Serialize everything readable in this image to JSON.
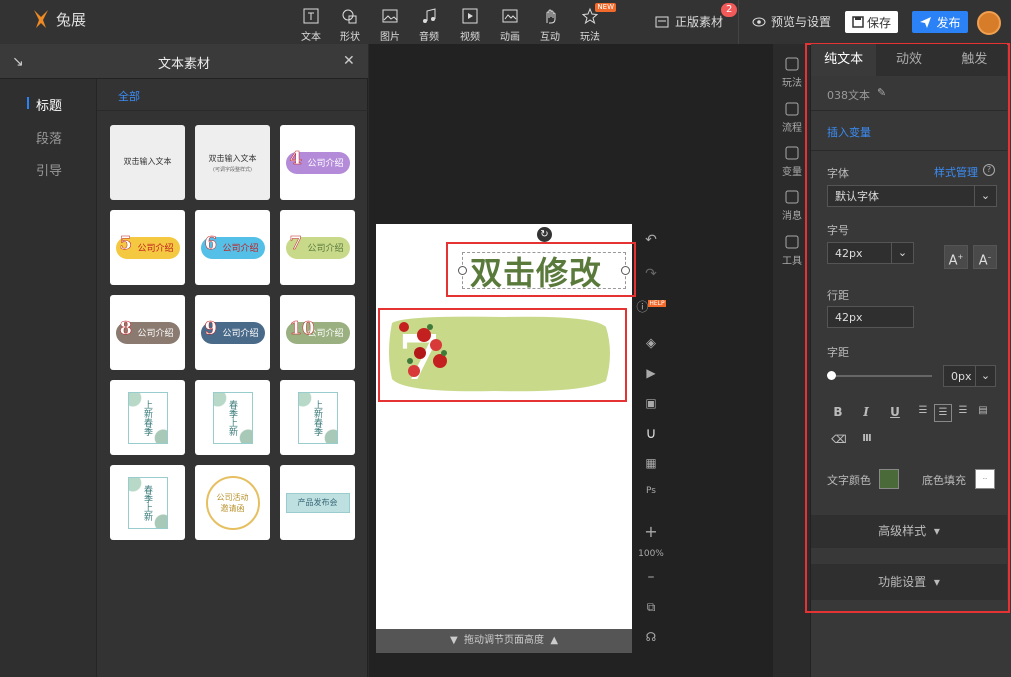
{
  "app": {
    "name": "兔展"
  },
  "toolbar": {
    "tools": [
      {
        "label": "文本",
        "icon": "text-icon"
      },
      {
        "label": "形状",
        "icon": "shape-icon"
      },
      {
        "label": "图片",
        "icon": "image-icon"
      },
      {
        "label": "音频",
        "icon": "music-icon"
      },
      {
        "label": "视频",
        "icon": "video-icon"
      },
      {
        "label": "动画",
        "icon": "animation-icon"
      },
      {
        "label": "互动",
        "icon": "hand-icon"
      },
      {
        "label": "玩法",
        "icon": "star-icon",
        "badge": "NEW"
      }
    ],
    "licensed_material": "正版素材",
    "licensed_count": "2",
    "preview_settings": "预览与设置",
    "save": "保存",
    "publish": "发布"
  },
  "left_panel": {
    "title": "文本素材",
    "categories": [
      "标题",
      "段落",
      "引导"
    ],
    "active_category": "标题",
    "filter_all": "全部",
    "cards": [
      {
        "type": "plain",
        "text": "双击输入文本",
        "sub": ""
      },
      {
        "type": "plain",
        "text": "双击输入文本",
        "sub": "(可调字段整样式)"
      },
      {
        "type": "pill",
        "num": "4",
        "text": "公司介绍",
        "color": "#b38bd9",
        "textColor": "#fff"
      },
      {
        "type": "pill",
        "num": "5",
        "text": "公司介绍",
        "color": "#f5c842",
        "textColor": "#c02020"
      },
      {
        "type": "pill",
        "num": "6",
        "text": "公司介绍",
        "color": "#54c0e8",
        "textColor": "#c02020"
      },
      {
        "type": "pill",
        "num": "7",
        "text": "公司介绍",
        "color": "#c8d98a",
        "textColor": "#5a7a3c"
      },
      {
        "type": "pill",
        "num": "8",
        "text": "公司介绍",
        "color": "#8a7a70",
        "textColor": "#fff"
      },
      {
        "type": "pill",
        "num": "9",
        "text": "公司介绍",
        "color": "#4a6a8a",
        "textColor": "#fff"
      },
      {
        "type": "pill",
        "num": "10",
        "text": "公司介绍",
        "color": "#9ab080",
        "textColor": "#fff"
      },
      {
        "type": "floral",
        "text": "上新春季"
      },
      {
        "type": "floral",
        "text": "春季上新"
      },
      {
        "type": "floral",
        "text": "上新春季"
      },
      {
        "type": "floral",
        "text": "春季上新"
      },
      {
        "type": "ring",
        "text": "公司活动邀请函"
      },
      {
        "type": "banner",
        "text": "产品发布会"
      }
    ]
  },
  "canvas": {
    "selected_text": "双击修改",
    "element_number": "7",
    "page_footer": "拖动调节页面高度",
    "zoom": "100%",
    "help": "HELP"
  },
  "icon_strip": [
    {
      "label": "玩法",
      "icon": "play-edit-icon"
    },
    {
      "label": "流程",
      "icon": "flow-icon"
    },
    {
      "label": "变量",
      "icon": "variable-icon"
    },
    {
      "label": "消息",
      "icon": "message-icon"
    },
    {
      "label": "工具",
      "icon": "toolbox-icon"
    }
  ],
  "right_panel": {
    "tabs": [
      "纯文本",
      "动效",
      "触发"
    ],
    "active_tab": "纯文本",
    "element_name": "038文本",
    "insert_variable": "插入变量",
    "font_label": "字体",
    "style_manage": "样式管理",
    "font_value": "默认字体",
    "size_label": "字号",
    "size_value": "42px",
    "line_height_label": "行距",
    "line_height_value": "42px",
    "letter_spacing_label": "字距",
    "letter_spacing_value": "0px",
    "text_color_label": "文字颜色",
    "text_color": "#4a6a3a",
    "bg_fill_label": "底色填充",
    "advanced_style": "高级样式",
    "function_settings": "功能设置"
  }
}
